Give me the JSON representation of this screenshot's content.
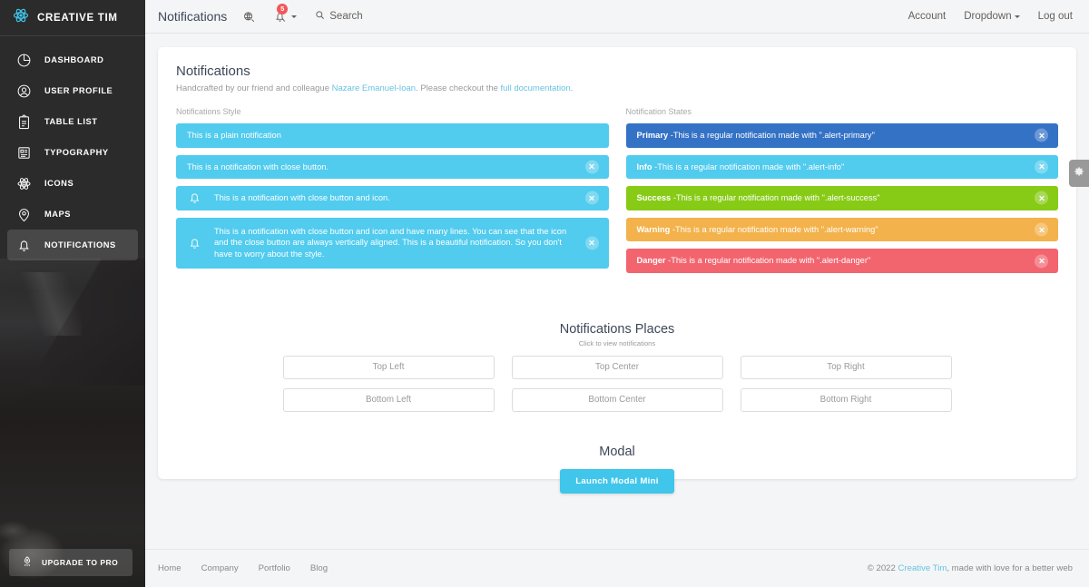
{
  "brand": {
    "name": "CREATIVE TIM",
    "logo_icon": "react-atom-icon"
  },
  "sidebar": {
    "items": [
      {
        "label": "DASHBOARD",
        "icon": "pie-chart-icon",
        "active": false
      },
      {
        "label": "USER PROFILE",
        "icon": "user-circle-icon",
        "active": false
      },
      {
        "label": "TABLE LIST",
        "icon": "clipboard-icon",
        "active": false
      },
      {
        "label": "TYPOGRAPHY",
        "icon": "text-page-icon",
        "active": false
      },
      {
        "label": "ICONS",
        "icon": "atom-icon",
        "active": false
      },
      {
        "label": "MAPS",
        "icon": "map-pin-icon",
        "active": false
      },
      {
        "label": "NOTIFICATIONS",
        "icon": "bell-icon",
        "active": true
      }
    ],
    "upgrade": {
      "label": "UPGRADE TO PRO",
      "icon": "rocket-icon"
    }
  },
  "navbar": {
    "title": "Notifications",
    "dashboard_icon": "dashboard-globe-icon",
    "notifications_icon": "bell-icon",
    "notifications_badge": "5",
    "search": {
      "label": "Search",
      "icon": "search-icon"
    },
    "right_links": [
      {
        "label": "Account",
        "caret": false
      },
      {
        "label": "Dropdown",
        "caret": true
      },
      {
        "label": "Log out",
        "caret": false
      }
    ]
  },
  "card": {
    "title": "Notifications",
    "subtitle_pre": "Handcrafted by our friend and colleague ",
    "subtitle_link1": "Nazare Emanuel-Ioan",
    "subtitle_mid": ". Please checkout the ",
    "subtitle_link2": "full documentation",
    "subtitle_post": ".",
    "left_col_label": "Notifications Style",
    "right_col_label": "Notification States"
  },
  "styles_alerts": [
    {
      "text": "This is a plain notification",
      "color": "#51cbee",
      "close": false,
      "icon": false,
      "multiline": false
    },
    {
      "text": "This is a notification with close button.",
      "color": "#51cbee",
      "close": true,
      "icon": false,
      "multiline": false
    },
    {
      "text": "This is a notification with close button and icon.",
      "color": "#51cbee",
      "close": true,
      "icon": true,
      "multiline": false
    },
    {
      "text": "This is a notification with close button and icon and have many lines. You can see that the icon and the close button are always vertically aligned. This is a beautiful notification. So you don't have to worry about the style.",
      "color": "#51cbee",
      "close": true,
      "icon": true,
      "multiline": true
    }
  ],
  "state_alerts": [
    {
      "state": "Primary",
      "text": " -This is a regular notification made with \".alert-primary\"",
      "color": "#3472c6",
      "close": true
    },
    {
      "state": "Info",
      "text": " -This is a regular notification made with \".alert-info\"",
      "color": "#51cbee",
      "close": true
    },
    {
      "state": "Success",
      "text": " -This is a regular notification made with \".alert-success\"",
      "color": "#87cb16",
      "close": true
    },
    {
      "state": "Warning",
      "text": " -This is a regular notification made with \".alert-warning\"",
      "color": "#f3b24b",
      "close": true
    },
    {
      "state": "Danger",
      "text": " -This is a regular notification made with \".alert-danger\"",
      "color": "#f2656f",
      "close": true
    }
  ],
  "places": {
    "title": "Notifications Places",
    "subtitle": "Click to view notifications",
    "row1": [
      "Top Left",
      "Top Center",
      "Top Right"
    ],
    "row2": [
      "Bottom Left",
      "Bottom Center",
      "Bottom Right"
    ]
  },
  "modal": {
    "title": "Modal",
    "button_label": "Launch Modal Mini",
    "button_color": "#3fc6ea"
  },
  "settings_tab": {
    "icon": "gear-icon"
  },
  "footer": {
    "links": [
      "Home",
      "Company",
      "Portfolio",
      "Blog"
    ],
    "copy_pre": "© 2022 ",
    "copy_link": "Creative Tim",
    "copy_post": ", made with love for a better web"
  },
  "colors": {
    "accent": "#51cbee",
    "sidebar_bg": "#2b2b2b",
    "page_bg": "#f4f5f7",
    "badge": "#f2565a"
  }
}
